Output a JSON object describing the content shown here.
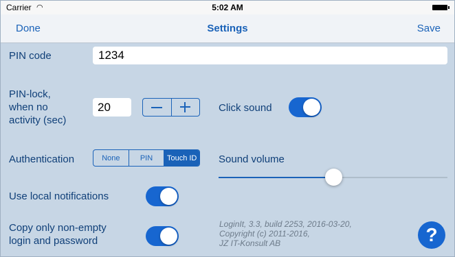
{
  "status_bar": {
    "carrier": "Carrier",
    "wifi_icon": "wifi-icon",
    "time": "5:02 AM",
    "battery_icon": "battery-icon"
  },
  "nav": {
    "done_label": "Done",
    "title": "Settings",
    "save_label": "Save"
  },
  "pin_code": {
    "label": "PIN code",
    "value": "1234"
  },
  "pin_lock": {
    "label_lines": [
      "PIN-lock,",
      "when no",
      "activity (sec)"
    ],
    "value": "20",
    "decrement_icon": "minus-icon",
    "increment_icon": "plus-icon"
  },
  "click_sound": {
    "label": "Click sound",
    "enabled": true
  },
  "authentication": {
    "label": "Authentication",
    "options": [
      "None",
      "PIN",
      "Touch ID"
    ],
    "selected": "Touch ID"
  },
  "sound_volume": {
    "label": "Sound volume",
    "value_fraction": 0.5
  },
  "local_notifications": {
    "label": "Use local notifications",
    "enabled": true
  },
  "copy_only_nonempty": {
    "label_lines": [
      "Copy only non-empty",
      "login and password"
    ],
    "enabled": true
  },
  "app_info": {
    "lines": [
      "LoginIt, 3.3, build 2253, 2016-03-20,",
      "Copyright (c) 2011-2016,",
      "JZ IT-Konsult AB"
    ]
  },
  "help": {
    "glyph": "?",
    "icon": "help-icon"
  },
  "colors": {
    "accent": "#1766d0",
    "background": "#c7d6e5",
    "label": "#0f3f78"
  }
}
